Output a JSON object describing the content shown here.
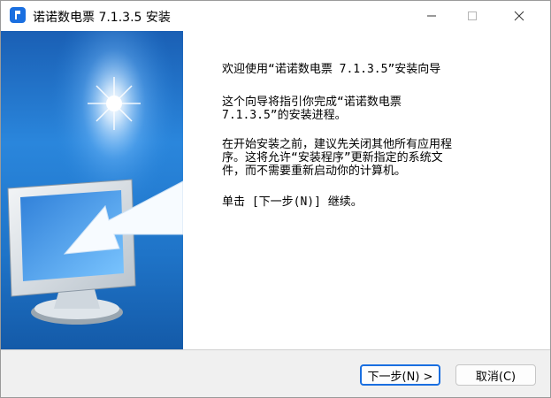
{
  "window": {
    "title": "诺诺数电票 7.1.3.5 安装",
    "icon": "app-logo-icon",
    "controls": [
      "minimize-icon",
      "maximize-icon",
      "close-icon"
    ]
  },
  "welcome": {
    "heading": "欢迎使用“诺诺数电票 7.1.3.5”安装向导",
    "para1": "这个向导将指引你完成“诺诺数电票\n7.1.3.5”的安装进程。",
    "para2": "在开始安装之前，建议先关闭其他所有应用程\n序。这将允许“安装程序”更新指定的系统文\n件，而不需要重新启动你的计算机。",
    "para3": "单击 [下一步(N)] 继续。"
  },
  "buttons": {
    "next": "下一步(N) >",
    "cancel": "取消(C)"
  },
  "colors": {
    "accent": "#1a6fe0",
    "banner_blue": "#1f74c8",
    "footer_bg": "#f0f0f0"
  }
}
